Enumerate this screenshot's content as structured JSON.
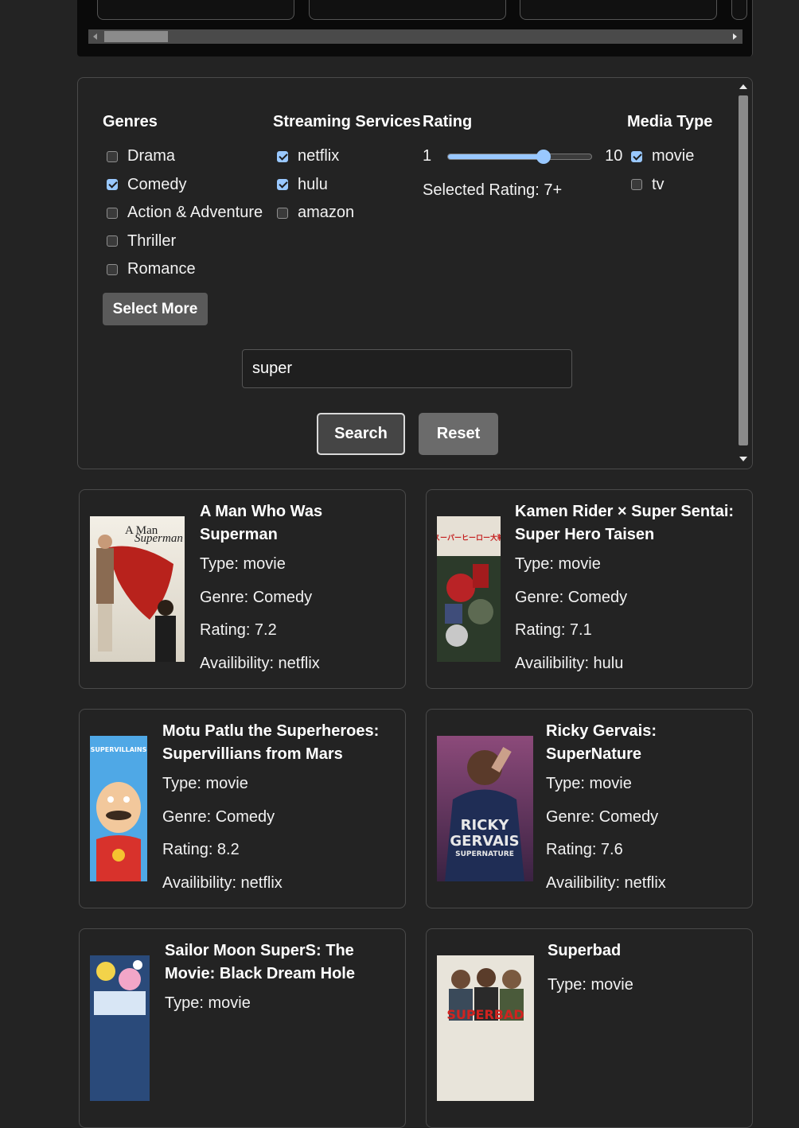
{
  "filters": {
    "genres": {
      "heading": "Genres",
      "options": [
        {
          "label": "Drama",
          "checked": false
        },
        {
          "label": "Comedy",
          "checked": true
        },
        {
          "label": "Action & Adventure",
          "checked": false
        },
        {
          "label": "Thriller",
          "checked": false
        },
        {
          "label": "Romance",
          "checked": false
        }
      ],
      "select_more_label": "Select More"
    },
    "services": {
      "heading": "Streaming Services",
      "options": [
        {
          "label": "netflix",
          "checked": true
        },
        {
          "label": "hulu",
          "checked": true
        },
        {
          "label": "amazon",
          "checked": false
        }
      ]
    },
    "rating": {
      "heading": "Rating",
      "min_label": "1",
      "max_label": "10",
      "min": 1,
      "max": 10,
      "value": 7,
      "selected_text": "Selected Rating: 7+"
    },
    "media_type": {
      "heading": "Media Type",
      "options": [
        {
          "label": "movie",
          "checked": true
        },
        {
          "label": "tv",
          "checked": false
        }
      ]
    },
    "search": {
      "value": "super"
    },
    "buttons": {
      "search": "Search",
      "reset": "Reset"
    }
  },
  "results": [
    {
      "title": "A Man Who Was Superman",
      "type": "Type: movie",
      "genre": "Genre: Comedy",
      "rating": "Rating: 7.2",
      "availability": "Availibility: netflix"
    },
    {
      "title": "Kamen Rider × Super Sentai: Super Hero Taisen",
      "type": "Type: movie",
      "genre": "Genre: Comedy",
      "rating": "Rating: 7.1",
      "availability": "Availibility: hulu"
    },
    {
      "title": "Motu Patlu the Superheroes: Supervillians from Mars",
      "type": "Type: movie",
      "genre": "Genre: Comedy",
      "rating": "Rating: 8.2",
      "availability": "Availibility: netflix"
    },
    {
      "title": "Ricky Gervais: SuperNature",
      "type": "Type: movie",
      "genre": "Genre: Comedy",
      "rating": "Rating: 7.6",
      "availability": "Availibility: netflix"
    },
    {
      "title": "Sailor Moon SuperS: The Movie: Black Dream Hole",
      "type": "Type: movie"
    },
    {
      "title": "Superbad",
      "type": "Type: movie"
    }
  ],
  "posters": {
    "superman": {
      "text_top": "A Man",
      "text_mid": "Superman"
    },
    "kamen": {
      "text": "スーパーヒーロー大戦"
    },
    "motu": {
      "text": "SUPERVILLAINS"
    },
    "ricky": {
      "line1": "RICKY",
      "line2": "GERVAIS",
      "line3": "SUPERNATURE"
    },
    "superbad": {
      "text": "SUPERBAD"
    }
  },
  "colors": {
    "accent": "#99c8ff",
    "background": "#232323",
    "border": "#4a4a4a"
  }
}
